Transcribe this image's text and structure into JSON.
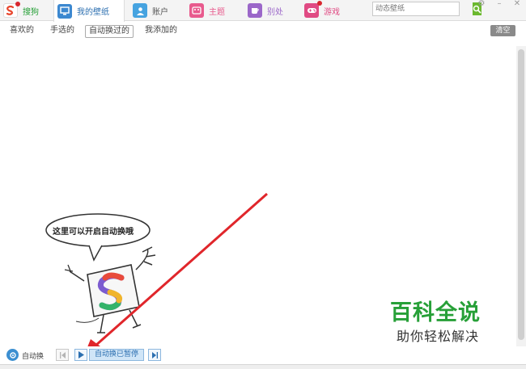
{
  "tabs": [
    {
      "label": "搜狗",
      "icon": "sogou-logo-icon",
      "color": "#ffffff",
      "badge": true
    },
    {
      "label": "我的壁纸",
      "icon": "monitor-icon",
      "color": "#3c88d0",
      "badge": false
    },
    {
      "label": "账户",
      "icon": "user-icon",
      "color": "#46a3e0",
      "badge": false
    },
    {
      "label": "主题",
      "icon": "theme-icon",
      "color": "#e85a8d",
      "badge": false
    },
    {
      "label": "别处",
      "icon": "cup-icon",
      "color": "#9b67c9",
      "badge": false
    },
    {
      "label": "游戏",
      "icon": "gamepad-icon",
      "color": "#e04a83",
      "badge": true
    }
  ],
  "active_tab": "我的壁纸",
  "search": {
    "placeholder": "动态壁纸"
  },
  "subtabs": [
    "喜欢的",
    "手选的",
    "自动换过的",
    "我添加的"
  ],
  "active_subtab": "自动换过的",
  "clear_label": "清空",
  "mascot": {
    "speech": "这里可以开启自动换哦"
  },
  "bottom": {
    "auto_label": "自动换",
    "status_label": "自动换已暂停"
  },
  "watermark": {
    "title": "百科全说",
    "subtitle": "助你轻松解决"
  },
  "colors": {
    "accent": "#3c88d0",
    "arrow": "#e0262b",
    "watermark_green": "#27a038"
  }
}
